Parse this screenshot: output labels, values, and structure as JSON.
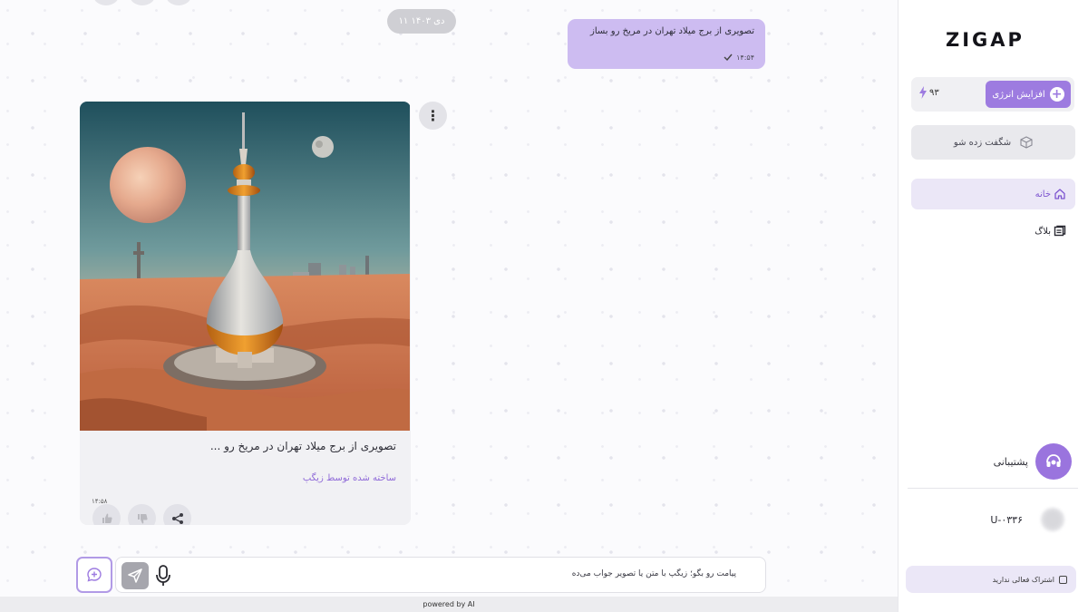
{
  "chat": {
    "date_label": "۱۱ دی ۱۴۰۳",
    "user_message": {
      "text": "تصویری از برج میلاد تهران در مریخ رو بساز",
      "time": "۱۴:۵۴",
      "status_icon": "check-icon"
    },
    "bot_message": {
      "caption": "تصویری از برج میلاد تهران در مریخ رو ...",
      "made_by": "ساخته شده توسط زیگپ",
      "time": "۱۴:۵۸",
      "image_alt": "Milad Tower on Mars"
    }
  },
  "composer": {
    "placeholder": "پیامت رو بگو؛ زیگپ با متن یا تصویر جواب می‌ده"
  },
  "footer": {
    "powered": "powered by AI"
  },
  "sidebar": {
    "logo": "ZIGAP",
    "energy_button": "افزایش انرژی",
    "energy_count": "۹۳",
    "surprise_button": "شگفت زده شو",
    "nav": [
      {
        "label": "خانه"
      },
      {
        "label": "بلاگ"
      }
    ],
    "support_label": "پشتیبانی",
    "user_id": "U-۰۳۳۶",
    "subscription_label": "اشتراک فعالی ندارید"
  },
  "colors": {
    "accent": "#9d7be0",
    "user_bubble": "#cdbcf1",
    "nav_active_bg": "#ebe7f7"
  }
}
